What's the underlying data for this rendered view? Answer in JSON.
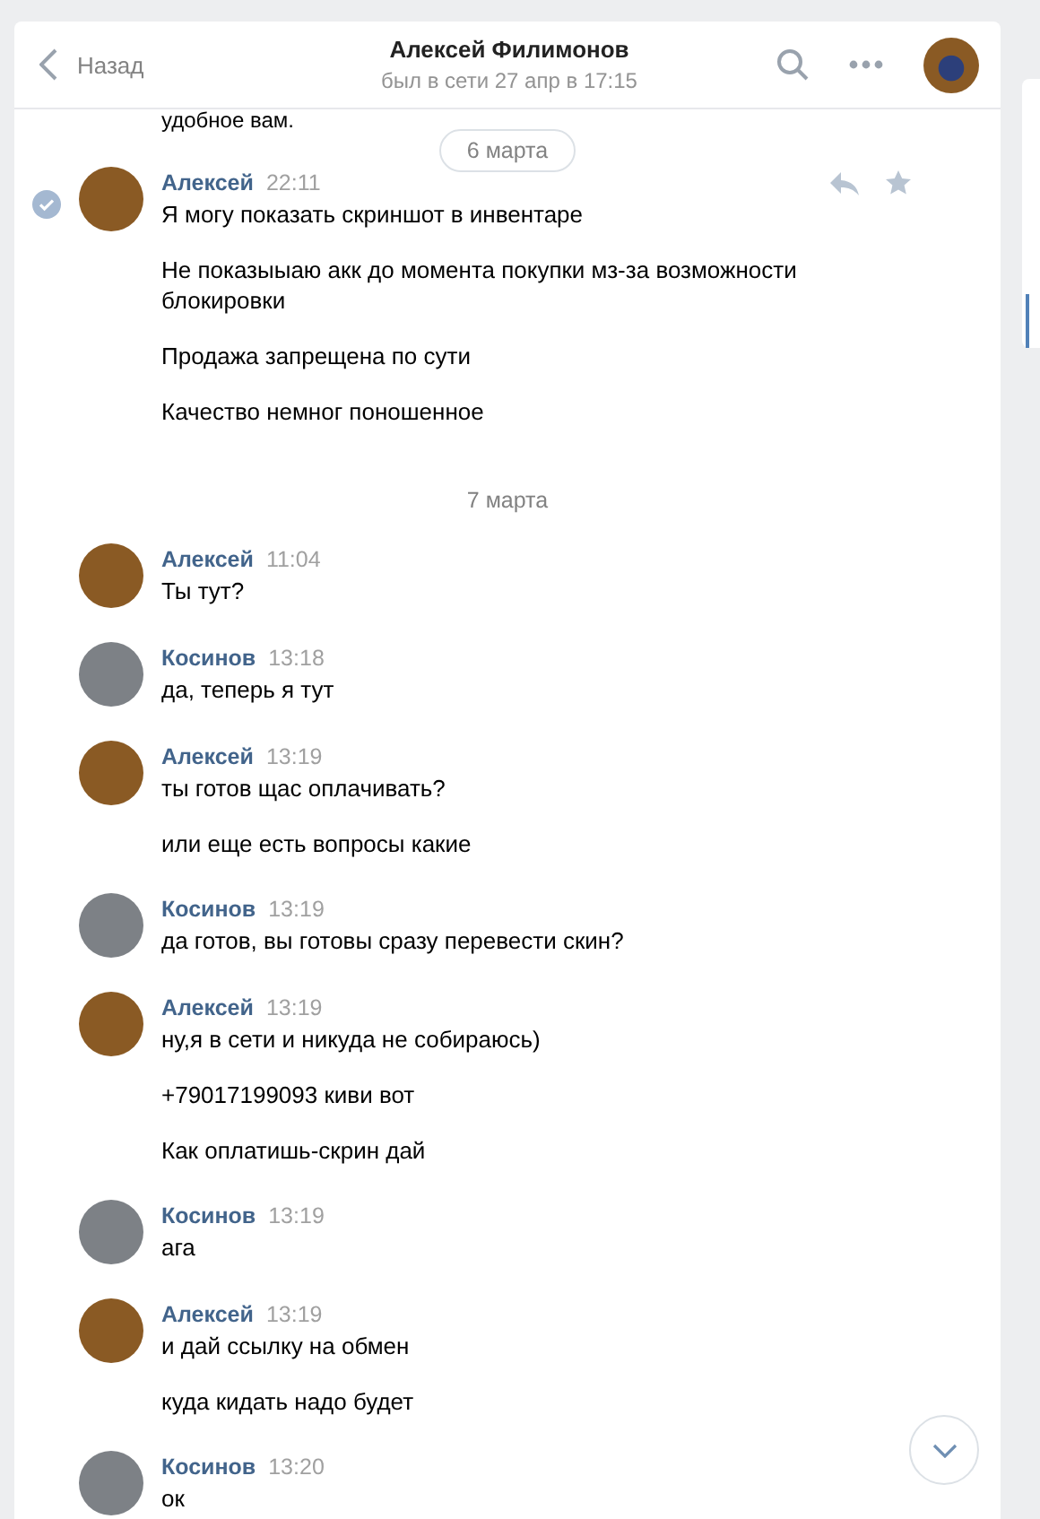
{
  "header": {
    "back": "Назад",
    "title": "Алексей Филимонов",
    "status": "был в сети 27 апр в 17:15"
  },
  "cut_text": "удобное вам.",
  "feed": [
    {
      "kind": "date",
      "label": "6 марта",
      "pill": true
    },
    {
      "kind": "message",
      "author": "Алексей",
      "color": "#8a5a24",
      "time": "22:11",
      "selected": true,
      "lines": [
        "Я могу показать скриншот в инвентаре",
        "Не показыыаю акк до момента покупки мз-за возможности блокировки",
        "Продажа запрещена по сути",
        "Качество немног поношенное"
      ]
    },
    {
      "kind": "date",
      "label": "7 марта",
      "pill": false
    },
    {
      "kind": "message",
      "author": "Алексей",
      "color": "#8a5a24",
      "time": "11:04",
      "selected": false,
      "lines": [
        "Ты тут?"
      ]
    },
    {
      "kind": "message",
      "author": "Косинов",
      "color": "#7d8186",
      "time": "13:18",
      "selected": false,
      "lines": [
        "да, теперь я тут"
      ]
    },
    {
      "kind": "message",
      "author": "Алексей",
      "color": "#8a5a24",
      "time": "13:19",
      "selected": false,
      "lines": [
        "ты готов щас оплачивать?",
        "или еще есть вопросы какие"
      ]
    },
    {
      "kind": "message",
      "author": "Косинов",
      "color": "#7d8186",
      "time": "13:19",
      "selected": false,
      "lines": [
        "да готов, вы готовы сразу перевести скин?"
      ]
    },
    {
      "kind": "message",
      "author": "Алексей",
      "color": "#8a5a24",
      "time": "13:19",
      "selected": false,
      "lines": [
        "ну,я в сети и никуда не собираюсь)",
        "+79017199093 киви вот",
        "Как оплатишь-скрин дай"
      ]
    },
    {
      "kind": "message",
      "author": "Косинов",
      "color": "#7d8186",
      "time": "13:19",
      "selected": false,
      "lines": [
        "ага"
      ]
    },
    {
      "kind": "message",
      "author": "Алексей",
      "color": "#8a5a24",
      "time": "13:19",
      "selected": false,
      "lines": [
        "и дай ссылку на обмен",
        "куда кидать надо будет"
      ]
    },
    {
      "kind": "message",
      "author": "Косинов",
      "color": "#7d8186",
      "time": "13:20",
      "selected": false,
      "lines": [
        "ок"
      ]
    }
  ]
}
